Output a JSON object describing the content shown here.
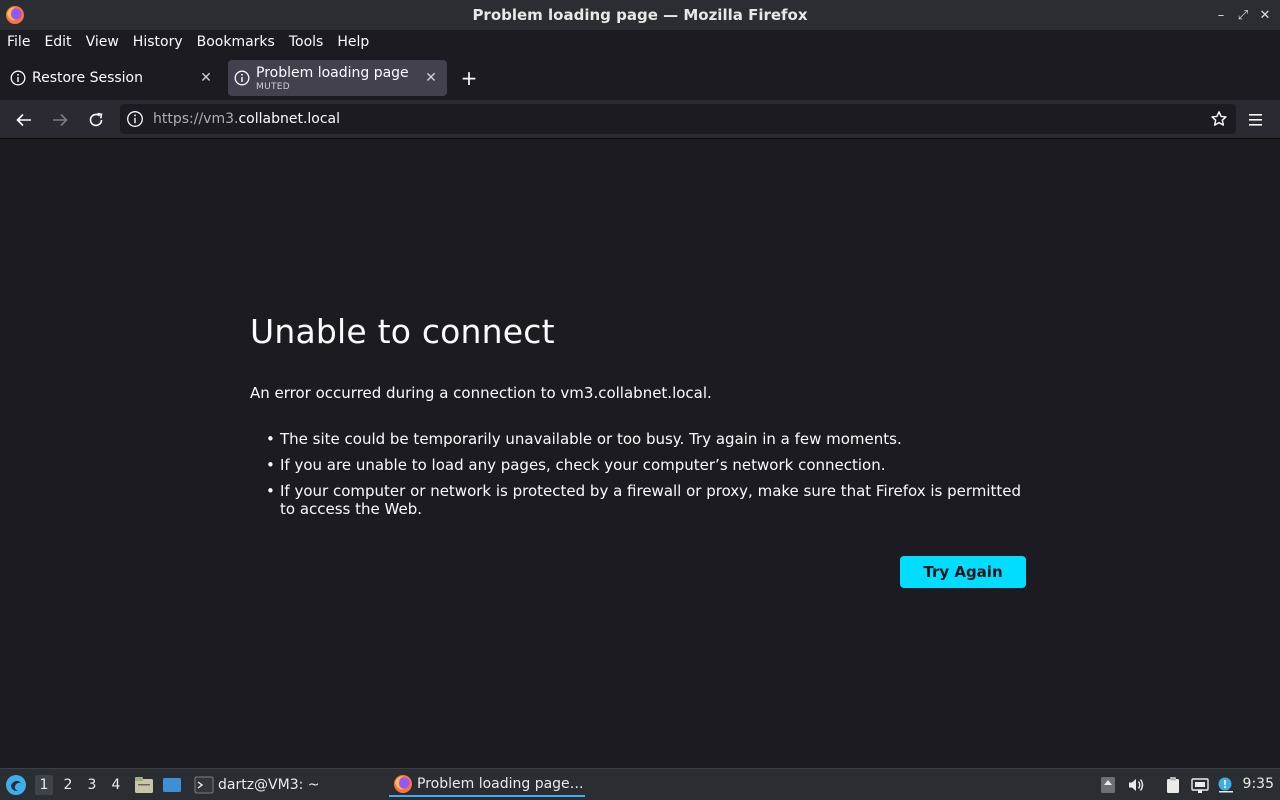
{
  "window": {
    "title": "Problem loading page — Mozilla Firefox"
  },
  "menu": [
    "File",
    "Edit",
    "View",
    "History",
    "Bookmarks",
    "Tools",
    "Help"
  ],
  "tabs": [
    {
      "label": "Restore Session",
      "sub": ""
    },
    {
      "label": "Problem loading page",
      "sub": "MUTED"
    }
  ],
  "urlbar": {
    "scheme": "https://vm3.",
    "host": "collabnet.local"
  },
  "error": {
    "title": "Unable to connect",
    "desc": "An error occurred during a connection to vm3.collabnet.local.",
    "items": [
      "The site could be temporarily unavailable or too busy. Try again in a few moments.",
      "If you are unable to load any pages, check your computer’s network connection.",
      "If your computer or network is protected by a firewall or proxy, make sure that Firefox is permitted to access the Web."
    ],
    "button": "Try Again"
  },
  "taskbar": {
    "workspaces": [
      "1",
      "2",
      "3",
      "4"
    ],
    "terminal_task": "dartz@VM3: ~",
    "firefox_task": "Problem loading page…",
    "clock": "9:35"
  },
  "colors": {
    "accent": "#00ddff",
    "page_bg": "#1c1b22",
    "toolbar_bg": "#2b2a33",
    "taskbar_bg": "#2a2e32"
  }
}
